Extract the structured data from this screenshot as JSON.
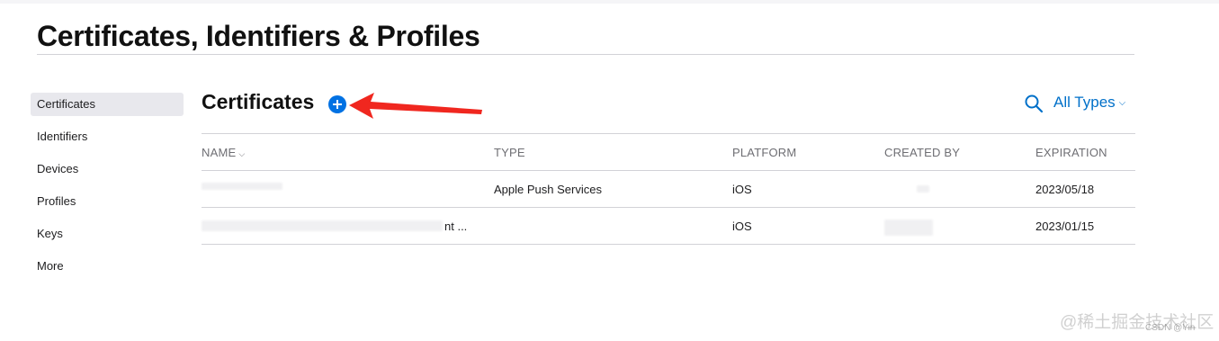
{
  "page": {
    "title": "Certificates, Identifiers & Profiles"
  },
  "sidebar": {
    "items": [
      {
        "label": "Certificates",
        "active": true
      },
      {
        "label": "Identifiers"
      },
      {
        "label": "Devices"
      },
      {
        "label": "Profiles"
      },
      {
        "label": "Keys"
      },
      {
        "label": "More"
      }
    ]
  },
  "section": {
    "title": "Certificates",
    "add_icon": "plus-circle-icon"
  },
  "toolbar": {
    "search_icon": "search-icon",
    "filter_label": "All Types",
    "filter_chevron": "⌵"
  },
  "table": {
    "columns": [
      {
        "label": "NAME",
        "sortable": true
      },
      {
        "label": "TYPE"
      },
      {
        "label": "PLATFORM"
      },
      {
        "label": "CREATED BY"
      },
      {
        "label": "EXPIRATION"
      }
    ],
    "rows": [
      {
        "name": "",
        "type": "Apple Push Services",
        "platform": "iOS",
        "created_by": "",
        "expiration": "2023/05/18"
      },
      {
        "name": "nt ...",
        "type": "",
        "platform": "iOS",
        "created_by": "",
        "expiration": "2023/01/15"
      }
    ]
  },
  "annotation": {
    "color": "#f0271f"
  },
  "watermark": {
    "line1": "@稀土掘金技术社区",
    "line2": "CSDN @Yin"
  },
  "colors": {
    "accent": "#0071e3",
    "link": "#0070c9",
    "active_bg": "#e8e8ed"
  }
}
